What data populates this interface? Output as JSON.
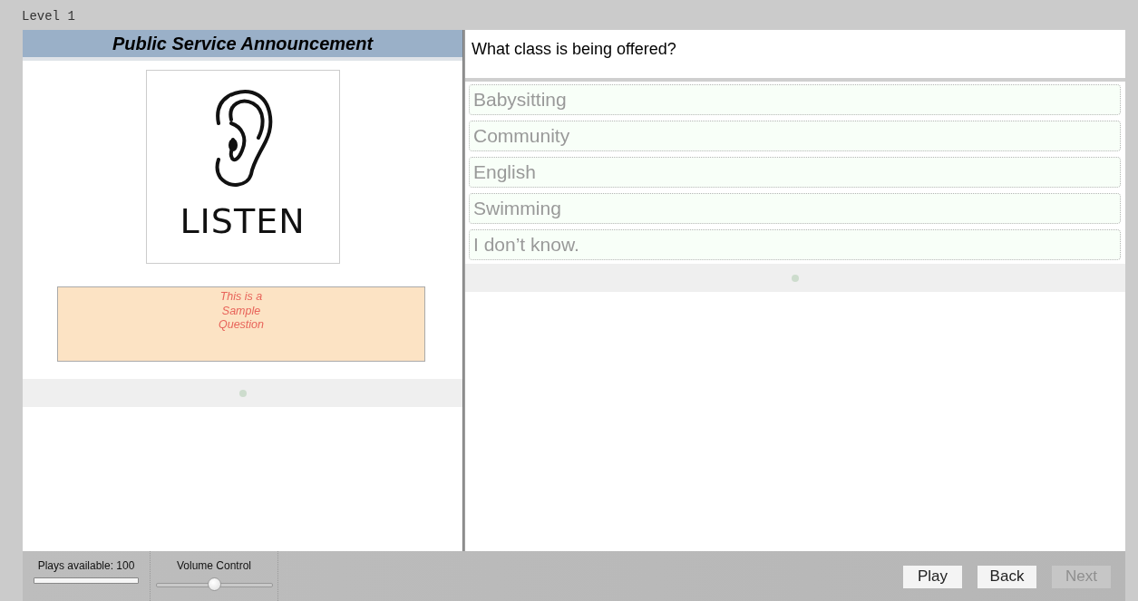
{
  "level_label": "Level 1",
  "stimulus": {
    "title": "Public Service Announcement",
    "image_caption": "LISTEN",
    "note": "This is a Sample Question"
  },
  "question": "What class is being offered?",
  "options": [
    {
      "label": "Babysitting",
      "selected": false
    },
    {
      "label": "Community",
      "selected": false
    },
    {
      "label": "English",
      "selected": false
    },
    {
      "label": "Swimming",
      "selected": false
    },
    {
      "label": "I don’t know.",
      "selected": false
    }
  ],
  "controls": {
    "plays_label": "Plays available: 100",
    "plays": {
      "level": 1
    },
    "volume_label": "Volume Control",
    "volume": {
      "level": 0.5
    }
  },
  "buttons": [
    {
      "label": "Play",
      "disabled": false
    },
    {
      "label": "Back",
      "disabled": false
    },
    {
      "label": "Next",
      "disabled": true
    }
  ]
}
